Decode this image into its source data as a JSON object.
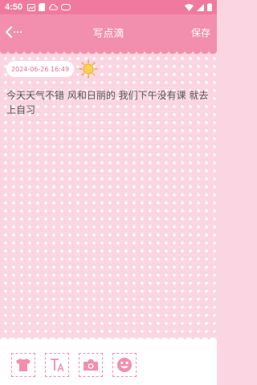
{
  "status": {
    "time": "4:50"
  },
  "nav": {
    "title": "写点滴",
    "save_label": "保存"
  },
  "entry": {
    "date": "2024-06-26 16:49",
    "weather_icon": "sun-icon",
    "text": "今天天气不错 风和日丽的 我们下午没有课 就去上自习"
  },
  "toolbar": {
    "buttons": [
      {
        "icon": "shirt-icon"
      },
      {
        "icon": "text-format-icon"
      },
      {
        "icon": "camera-icon"
      },
      {
        "icon": "emoji-icon"
      }
    ]
  },
  "colors": {
    "accent": "#f28fae",
    "status_bar": "#f07a9f",
    "background": "#fbd6e2"
  }
}
